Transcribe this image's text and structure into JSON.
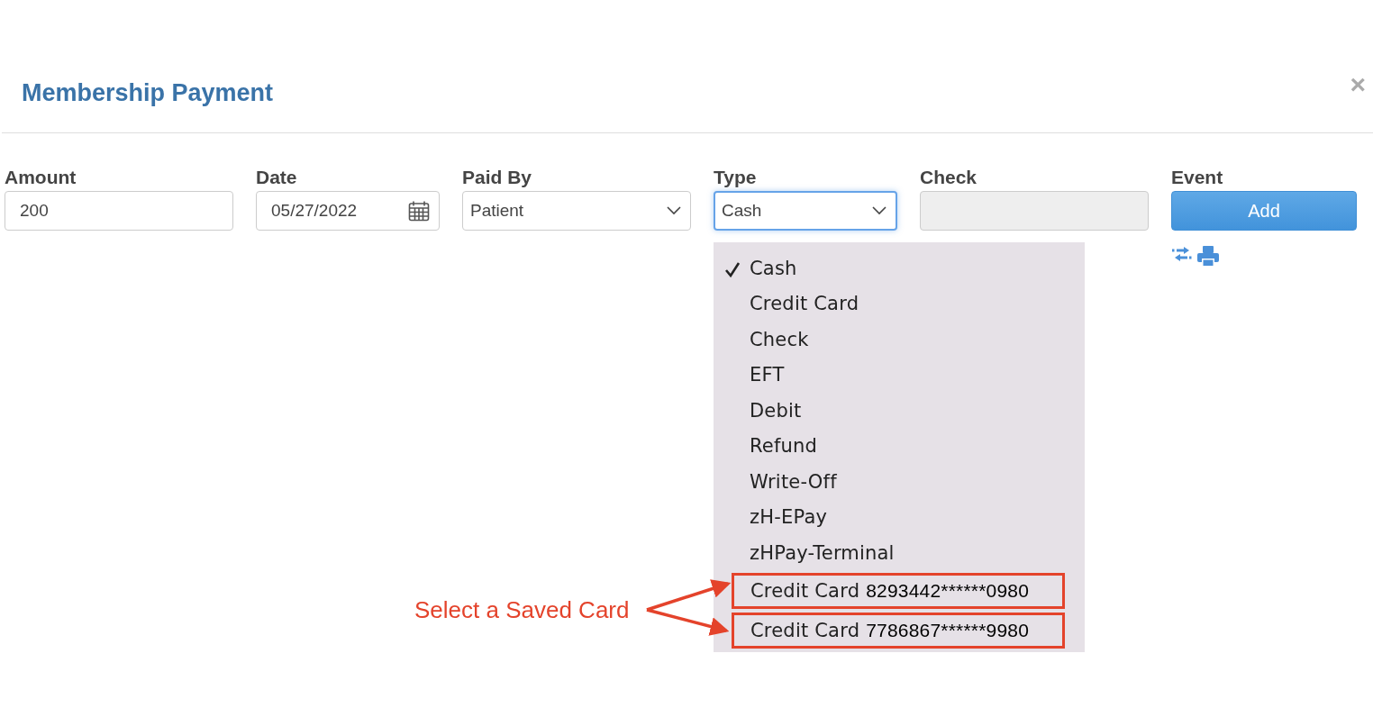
{
  "dialog": {
    "title": "Membership Payment",
    "close": "×"
  },
  "fields": [
    {
      "kind": "text",
      "label": "Amount",
      "value": "200",
      "disabled": false
    },
    {
      "kind": "date",
      "label": "Date",
      "value": "05/27/2022",
      "disabled": false
    },
    {
      "kind": "select",
      "label": "Paid By",
      "value": "Patient",
      "disabled": false,
      "focused": false
    },
    {
      "kind": "select",
      "label": "Type",
      "value": "Cash",
      "disabled": false,
      "focused": true
    },
    {
      "kind": "text",
      "label": "Check",
      "disabled": true
    },
    {
      "kind": "button",
      "label": "Event",
      "value": "Add",
      "disabled": false
    }
  ],
  "type_menu": {
    "items": [
      {
        "label": "Cash",
        "selected": true,
        "highlighted": false
      },
      {
        "label": "Credit Card",
        "selected": false,
        "highlighted": false
      },
      {
        "label": "Check",
        "selected": false,
        "highlighted": false
      },
      {
        "label": "EFT",
        "selected": false,
        "highlighted": false
      },
      {
        "label": "Debit",
        "selected": false,
        "highlighted": false
      },
      {
        "label": "Refund",
        "selected": false,
        "highlighted": false
      },
      {
        "label": "Write-Off",
        "selected": false,
        "highlighted": false
      },
      {
        "label": "zH-EPay",
        "selected": false,
        "highlighted": false
      },
      {
        "label": "zHPay-Terminal",
        "selected": false,
        "highlighted": false
      },
      {
        "label": "Credit Card",
        "number": "8293442******0980",
        "selected": false,
        "highlighted": true
      },
      {
        "label": "Credit Card",
        "number": "7786867******9980",
        "selected": false,
        "highlighted": true
      }
    ]
  },
  "annotation": {
    "text": "Select a Saved Card"
  }
}
